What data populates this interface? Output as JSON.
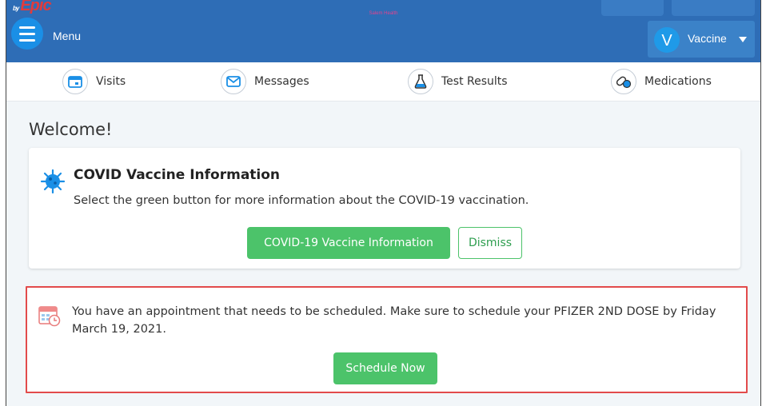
{
  "header": {
    "brand_prefix": "by",
    "brand": "Epic",
    "org": "Salem Health",
    "menu_label": "Menu",
    "user_initial": "V",
    "user_name": "Vaccine"
  },
  "nav": {
    "items": [
      {
        "label": "Visits",
        "icon": "calendar-icon"
      },
      {
        "label": "Messages",
        "icon": "envelope-icon"
      },
      {
        "label": "Test Results",
        "icon": "flask-icon"
      },
      {
        "label": "Medications",
        "icon": "pills-icon"
      }
    ]
  },
  "welcome": "Welcome!",
  "covid_card": {
    "title": "COVID Vaccine Information",
    "description": "Select the green button for more information about the COVID-19 vaccination.",
    "primary_button": "COVID-19 Vaccine Information",
    "dismiss_button": "Dismiss"
  },
  "appointment_card": {
    "text": "You have an appointment that needs to be scheduled. Make sure to schedule your PFIZER 2ND DOSE by Friday March 19, 2021.",
    "button": "Schedule Now"
  },
  "colors": {
    "header": "#2e6db6",
    "accent_green": "#4cc36a",
    "highlight_red": "#e24b4b"
  }
}
